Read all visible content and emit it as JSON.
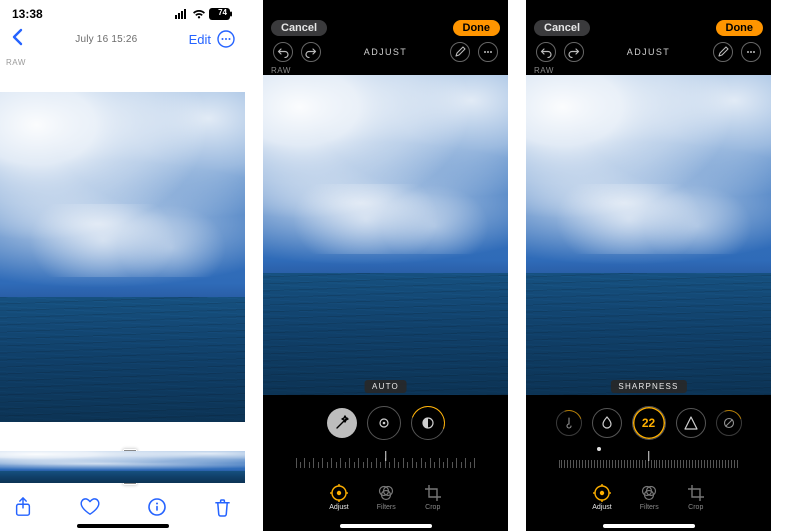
{
  "screenA": {
    "status": {
      "time": "13:38",
      "battery": "74"
    },
    "nav": {
      "date": "July 16  15:26",
      "edit": "Edit"
    },
    "raw": "RAW",
    "toolbar": {
      "share": "share-icon",
      "heart": "heart-icon",
      "info": "info-icon",
      "trash": "trash-icon"
    }
  },
  "screenB": {
    "nav": {
      "cancel": "Cancel",
      "done": "Done"
    },
    "section": "ADJUST",
    "raw": "RAW",
    "param": "AUTO",
    "tabs": {
      "adjust": "Adjust",
      "filters": "Filters",
      "crop": "Crop"
    }
  },
  "screenC": {
    "nav": {
      "cancel": "Cancel",
      "done": "Done"
    },
    "section": "ADJUST",
    "raw": "RAW",
    "param": "SHARPNESS",
    "value": "22",
    "tabs": {
      "adjust": "Adjust",
      "filters": "Filters",
      "crop": "Crop"
    }
  }
}
